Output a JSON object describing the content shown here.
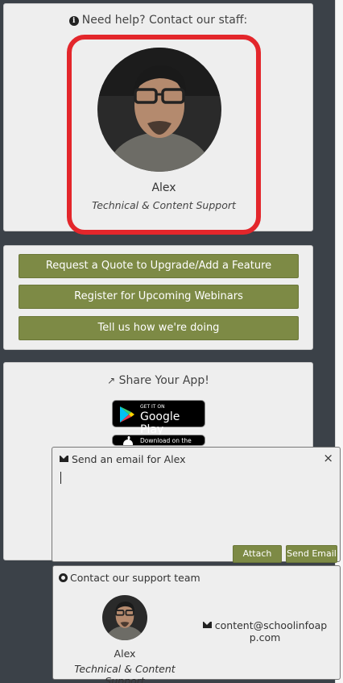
{
  "help": {
    "title": "Need help? Contact our staff:",
    "staff_name": "Alex",
    "staff_role": "Technical & Content Support"
  },
  "actions": {
    "quote": "Request a Quote to Upgrade/Add a Feature",
    "webinar": "Register for Upcoming Webinars",
    "feedback": "Tell us how we're doing"
  },
  "share": {
    "title": "Share Your App!",
    "google_small": "GET IT ON",
    "google_big": "Google Play",
    "apple_small": "Download on the"
  },
  "email_dialog": {
    "title": "Send an email for Alex",
    "close": "×",
    "attach": "Attach files",
    "send": "Send Email"
  },
  "support": {
    "title": "Contact our support team",
    "name": "Alex",
    "role": "Technical & Content Support",
    "email": "content@schoolinfoapp.com"
  },
  "colors": {
    "button_green": "#7d8a45",
    "highlight_red": "#e3262b",
    "panel_bg": "#eeeeee",
    "page_bg": "#3b4148"
  }
}
